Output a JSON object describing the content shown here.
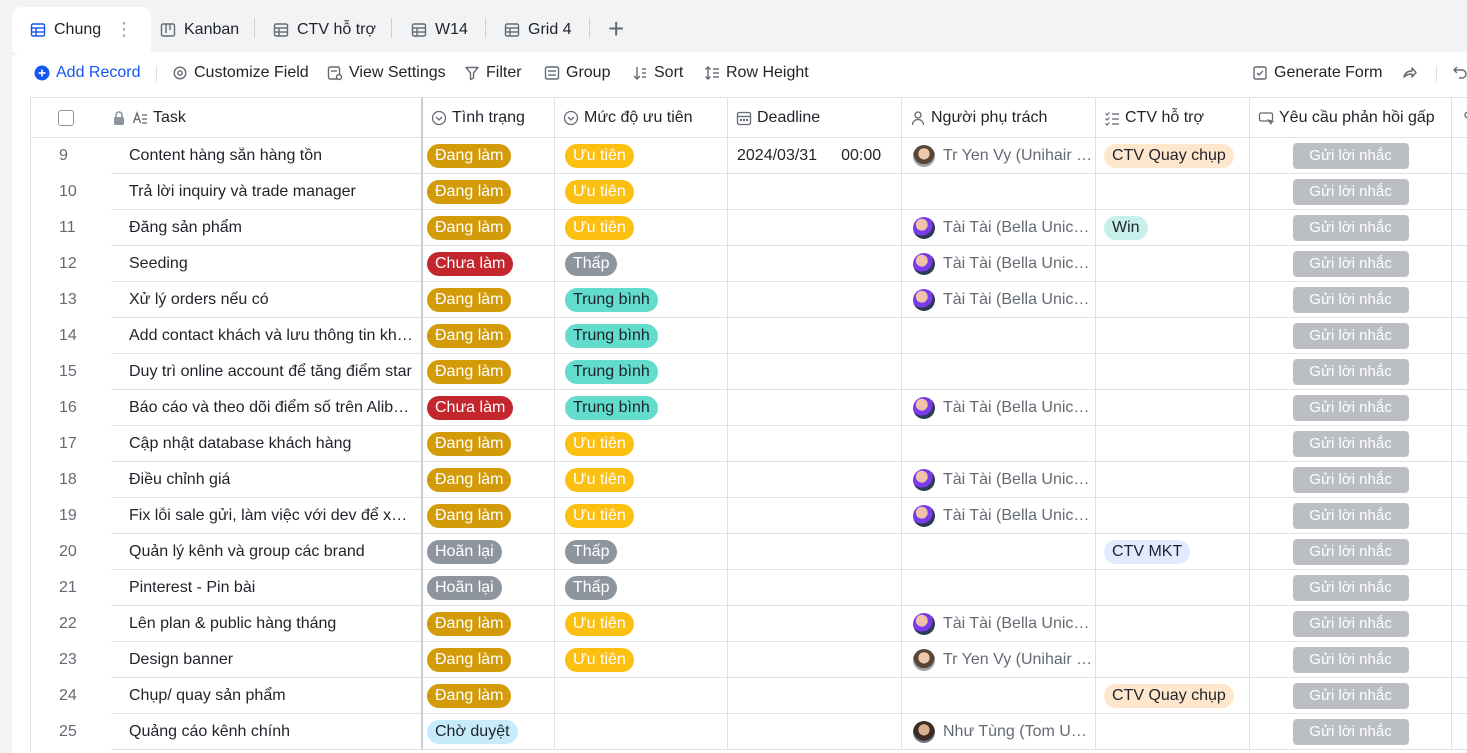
{
  "tabs": [
    {
      "label": "Chung",
      "icon": "grid-icon",
      "active": true
    },
    {
      "label": "Kanban",
      "icon": "kanban-icon"
    },
    {
      "label": "CTV hỗ trợ",
      "icon": "grid-icon"
    },
    {
      "label": "W14",
      "icon": "grid-icon"
    },
    {
      "label": "Grid 4",
      "icon": "grid-icon"
    }
  ],
  "toolbar": {
    "add_record": "Add Record",
    "customize_field": "Customize Field",
    "view_settings": "View Settings",
    "filter": "Filter",
    "group": "Group",
    "sort": "Sort",
    "row_height": "Row Height",
    "generate_form": "Generate Form"
  },
  "columns": {
    "task": "Task",
    "status": "Tình trạng",
    "priority": "Mức độ ưu tiên",
    "deadline": "Deadline",
    "owner": "Người phụ trách",
    "ctv": "CTV hỗ trợ",
    "request": "Yêu cầu phản hồi gấp"
  },
  "colors": {
    "Đang làm": {
      "bg": "#d39b0a",
      "fg": "#ffffff"
    },
    "Chưa làm": {
      "bg": "#c4262e",
      "fg": "#ffffff"
    },
    "Hoãn lại": {
      "bg": "#8f959e",
      "fg": "#ffffff"
    },
    "Chờ duyệt": {
      "bg": "#c6ecfb",
      "fg": "#1f2329"
    },
    "Ưu tiên": {
      "bg": "#fcc012",
      "fg": "#ffffff"
    },
    "Thấp": {
      "bg": "#8f959e",
      "fg": "#ffffff"
    },
    "Trung bình": {
      "bg": "#62dccd",
      "fg": "#1f2329"
    },
    "CTV Quay chụp": {
      "bg": "#fee7cd",
      "fg": "#1f2329"
    },
    "Win": {
      "bg": "#c7f0ea",
      "fg": "#1f2329"
    },
    "CTV MKT": {
      "bg": "#e1eaff",
      "fg": "#1f2329"
    }
  },
  "remind_label": "Gửi lời nhắc",
  "rows": [
    {
      "num": "9",
      "task": "Content hàng sẵn hàng tồn",
      "status": "Đang làm",
      "priority": "Ưu tiên",
      "date": "2024/03/31",
      "time": "00:00",
      "owner": "Tr Yen Vy (Unihair Hair)",
      "avatar": "av-b",
      "ctv": "CTV Quay chụp"
    },
    {
      "num": "10",
      "task": "Trả lời inquiry và trade manager",
      "status": "Đang làm",
      "priority": "Ưu tiên",
      "date": "",
      "time": "",
      "owner": "",
      "avatar": "",
      "ctv": ""
    },
    {
      "num": "11",
      "task": "Đăng sản phẩm",
      "status": "Đang làm",
      "priority": "Ưu tiên",
      "date": "",
      "time": "",
      "owner": "Tài Tài (Bella Unicorn)",
      "avatar": "av-a",
      "ctv": "Win"
    },
    {
      "num": "12",
      "task": "Seeding",
      "status": "Chưa làm",
      "priority": "Thấp",
      "date": "",
      "time": "",
      "owner": "Tài Tài (Bella Unicorn)",
      "avatar": "av-a",
      "ctv": ""
    },
    {
      "num": "13",
      "task": "Xử lý orders nếu có",
      "status": "Đang làm",
      "priority": "Trung bình",
      "date": "",
      "time": "",
      "owner": "Tài Tài (Bella Unicorn)",
      "avatar": "av-a",
      "ctv": ""
    },
    {
      "num": "14",
      "task": "Add contact khách và lưu thông tin khách hàng",
      "status": "Đang làm",
      "priority": "Trung bình",
      "date": "",
      "time": "",
      "owner": "",
      "avatar": "",
      "ctv": ""
    },
    {
      "num": "15",
      "task": "Duy trì online account để tăng điểm star",
      "status": "Đang làm",
      "priority": "Trung bình",
      "date": "",
      "time": "",
      "owner": "",
      "avatar": "",
      "ctv": ""
    },
    {
      "num": "16",
      "task": "Báo cáo và theo dõi điểm số trên Alibaba",
      "status": "Chưa làm",
      "priority": "Trung bình",
      "date": "",
      "time": "",
      "owner": "Tài Tài (Bella Unicorn)",
      "avatar": "av-a",
      "ctv": ""
    },
    {
      "num": "17",
      "task": "Cập nhật database khách hàng",
      "status": "Đang làm",
      "priority": "Ưu tiên",
      "date": "",
      "time": "",
      "owner": "",
      "avatar": "",
      "ctv": ""
    },
    {
      "num": "18",
      "task": "Điều chỉnh giá",
      "status": "Đang làm",
      "priority": "Ưu tiên",
      "date": "",
      "time": "",
      "owner": "Tài Tài (Bella Unicorn)",
      "avatar": "av-a",
      "ctv": ""
    },
    {
      "num": "19",
      "task": "Fix lỗi sale gửi, làm việc với dev để xử lý",
      "status": "Đang làm",
      "priority": "Ưu tiên",
      "date": "",
      "time": "",
      "owner": "Tài Tài (Bella Unicorn)",
      "avatar": "av-a",
      "ctv": ""
    },
    {
      "num": "20",
      "task": "Quản lý kênh và group các brand",
      "status": "Hoãn lại",
      "priority": "Thấp",
      "date": "",
      "time": "",
      "owner": "",
      "avatar": "",
      "ctv": "CTV MKT"
    },
    {
      "num": "21",
      "task": "Pinterest - Pin bài",
      "status": "Hoãn lại",
      "priority": "Thấp",
      "date": "",
      "time": "",
      "owner": "",
      "avatar": "",
      "ctv": ""
    },
    {
      "num": "22",
      "task": "Lên plan & public hàng tháng",
      "status": "Đang làm",
      "priority": "Ưu tiên",
      "date": "",
      "time": "",
      "owner": "Tài Tài (Bella Unicorn)",
      "avatar": "av-a",
      "ctv": ""
    },
    {
      "num": "23",
      "task": "Design banner",
      "status": "Đang làm",
      "priority": "Ưu tiên",
      "date": "",
      "time": "",
      "owner": "Tr Yen Vy (Unihair Hair)",
      "avatar": "av-b",
      "ctv": ""
    },
    {
      "num": "24",
      "task": "Chụp/ quay sản phẩm",
      "status": "Đang làm",
      "priority": "",
      "date": "",
      "time": "",
      "owner": "",
      "avatar": "",
      "ctv": "CTV Quay chụp"
    },
    {
      "num": "25",
      "task": "Quảng cáo kênh chính",
      "status": "Chờ duyệt",
      "priority": "",
      "date": "",
      "time": "",
      "owner": "Như Tùng (Tom Unicorn)",
      "avatar": "av-c",
      "ctv": ""
    }
  ]
}
